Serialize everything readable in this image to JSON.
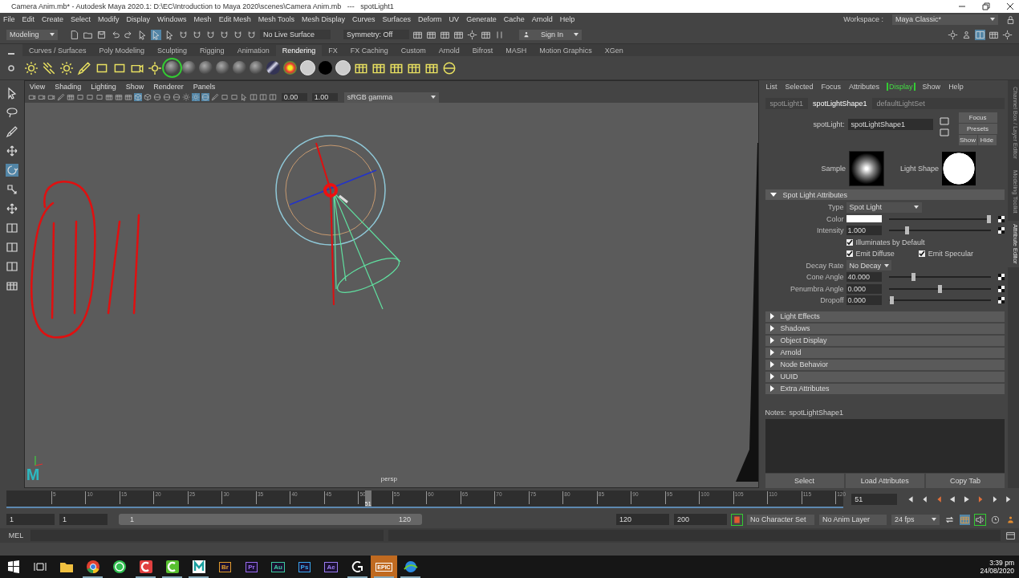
{
  "window": {
    "title": "Camera Anim.mb* - Autodesk Maya 2020.1: D:\\EC\\Introduction to Maya 2020\\scenes\\Camera Anim.mb   ---   spotLight1"
  },
  "menu_bar": [
    "File",
    "Edit",
    "Create",
    "Select",
    "Modify",
    "Display",
    "Windows",
    "Mesh",
    "Edit Mesh",
    "Mesh Tools",
    "Mesh Display",
    "Curves",
    "Surfaces",
    "Deform",
    "UV",
    "Generate",
    "Cache",
    "Arnold",
    "Help"
  ],
  "status_line": {
    "mode": "Modeling",
    "live_surface": "No Live Surface",
    "symmetry": "Symmetry: Off",
    "sign_in": "Sign In",
    "workspace_label": "Workspace :",
    "workspace": "Maya Classic*"
  },
  "shelf_tabs": [
    {
      "label": "Curves / Surfaces",
      "selected": false
    },
    {
      "label": "Poly Modeling",
      "selected": false
    },
    {
      "label": "Sculpting",
      "selected": false
    },
    {
      "label": "Rigging",
      "selected": false
    },
    {
      "label": "Animation",
      "selected": false
    },
    {
      "label": "Rendering",
      "selected": true
    },
    {
      "label": "FX",
      "selected": false
    },
    {
      "label": "FX Caching",
      "selected": false
    },
    {
      "label": "Custom",
      "selected": false
    },
    {
      "label": "Arnold",
      "selected": false
    },
    {
      "label": "Bifrost",
      "selected": false
    },
    {
      "label": "MASH",
      "selected": false
    },
    {
      "label": "Motion Graphics",
      "selected": false
    },
    {
      "label": "XGen",
      "selected": false
    }
  ],
  "viewport": {
    "menus": [
      "View",
      "Shading",
      "Lighting",
      "Show",
      "Renderer",
      "Panels"
    ],
    "exposure": "0.00",
    "gamma": "1.00",
    "color_space": "sRGB gamma",
    "camera": "persp",
    "logo": "M"
  },
  "attribute_editor": {
    "menus": [
      {
        "label": "List",
        "selected": false
      },
      {
        "label": "Selected",
        "selected": false
      },
      {
        "label": "Focus",
        "selected": false
      },
      {
        "label": "Attributes",
        "selected": false
      },
      {
        "label": "Display",
        "selected": true
      },
      {
        "label": "Show",
        "selected": false
      },
      {
        "label": "Help",
        "selected": false
      }
    ],
    "tabs": [
      {
        "label": "spotLight1",
        "selected": false
      },
      {
        "label": "spotLightShape1",
        "selected": true
      },
      {
        "label": "defaultLightSet",
        "selected": false
      }
    ],
    "node_label": "spotLight:",
    "node_name": "spotLightShape1",
    "buttons": [
      "Focus",
      "Presets",
      "Show",
      "Hide"
    ],
    "sample_label": "Sample",
    "light_shape_label": "Light Shape",
    "section": {
      "title": "Spot Light Attributes",
      "expanded": true
    },
    "attributes": [
      {
        "kind": "dropdown",
        "label": "Type",
        "value": "Spot Light"
      },
      {
        "kind": "color",
        "label": "Color",
        "level": 1
      },
      {
        "kind": "slider",
        "label": "Intensity",
        "value": "1.000",
        "level": 0.17
      },
      {
        "kind": "checks",
        "items": [
          {
            "label": "Illuminates by Default",
            "checked": true
          }
        ]
      },
      {
        "kind": "checks",
        "items": [
          {
            "label": "Emit Diffuse",
            "checked": true
          },
          {
            "label": "Emit Specular",
            "checked": true
          }
        ]
      },
      {
        "kind": "dropdown",
        "label": "Decay Rate",
        "value": "No Decay"
      },
      {
        "kind": "slider",
        "label": "Cone Angle",
        "value": "40.000",
        "level": 0.23
      },
      {
        "kind": "slider",
        "label": "Penumbra Angle",
        "value": "0.000",
        "level": 0.5
      },
      {
        "kind": "slider",
        "label": "Dropoff",
        "value": "0.000",
        "level": 0.01
      }
    ],
    "collapsed_sections": [
      {
        "title": "Light Effects",
        "expanded": false
      },
      {
        "title": "Shadows",
        "expanded": false
      },
      {
        "title": "Object Display",
        "expanded": false
      },
      {
        "title": "Arnold",
        "expanded": false
      },
      {
        "title": "Node Behavior",
        "expanded": false
      },
      {
        "title": "UUID",
        "expanded": false
      },
      {
        "title": "Extra Attributes",
        "expanded": false
      }
    ],
    "notes_label": "Notes:",
    "notes_node": "spotLightShape1",
    "bottom_buttons": [
      "Select",
      "Load Attributes",
      "Copy Tab"
    ]
  },
  "side_tabs": [
    {
      "label": "Channel Box / Layer Editor",
      "selected": false
    },
    {
      "label": "Modeling Toolkit",
      "selected": false
    },
    {
      "label": "Attribute Editor",
      "selected": true
    }
  ],
  "time_slider": {
    "ticks": [
      "5",
      "10",
      "15",
      "20",
      "25",
      "30",
      "35",
      "40",
      "45",
      "50",
      "55",
      "60",
      "65",
      "70",
      "75",
      "80",
      "85",
      "90",
      "95",
      "100",
      "105",
      "110",
      "115",
      "120"
    ],
    "current_frame": "51",
    "level": 0.42
  },
  "current_frame_field": "51",
  "range": {
    "start": "1",
    "playback_start": "1",
    "range_start": "1",
    "range_end": "120",
    "playback_end": "120",
    "end": "200",
    "character_set": "No Character Set",
    "anim_layer": "No Anim Layer",
    "fps": "24 fps"
  },
  "command_line": {
    "label": "MEL"
  },
  "taskbar": {
    "apps": [
      {
        "kind": "windows",
        "running": false
      },
      {
        "kind": "taskview",
        "running": false
      },
      {
        "kind": "folder",
        "running": false
      },
      {
        "kind": "chrome",
        "running": true
      },
      {
        "kind": "whatsapp",
        "running": false
      },
      {
        "kind": "camtasia",
        "color": "#e04040",
        "running": true
      },
      {
        "kind": "camtasia",
        "color": "#58c030",
        "running": true
      },
      {
        "kind": "maya",
        "running": true
      },
      {
        "kind": "badge",
        "label": "Br",
        "color": "#e09a2a",
        "running": false
      },
      {
        "kind": "badge",
        "label": "Pr",
        "color": "#9a6cf0",
        "running": false
      },
      {
        "kind": "badge",
        "label": "Au",
        "color": "#3ec9a0",
        "running": false
      },
      {
        "kind": "badge",
        "label": "Ps",
        "color": "#3aa6f0",
        "running": false
      },
      {
        "kind": "badge",
        "label": "Ae",
        "color": "#9a7cf0",
        "running": false
      },
      {
        "kind": "logitech",
        "running": true
      },
      {
        "kind": "epic",
        "label": "EPIC",
        "running": true
      },
      {
        "kind": "globe",
        "running": true
      }
    ],
    "time": "3:39 pm",
    "date": "24/08/2020"
  }
}
